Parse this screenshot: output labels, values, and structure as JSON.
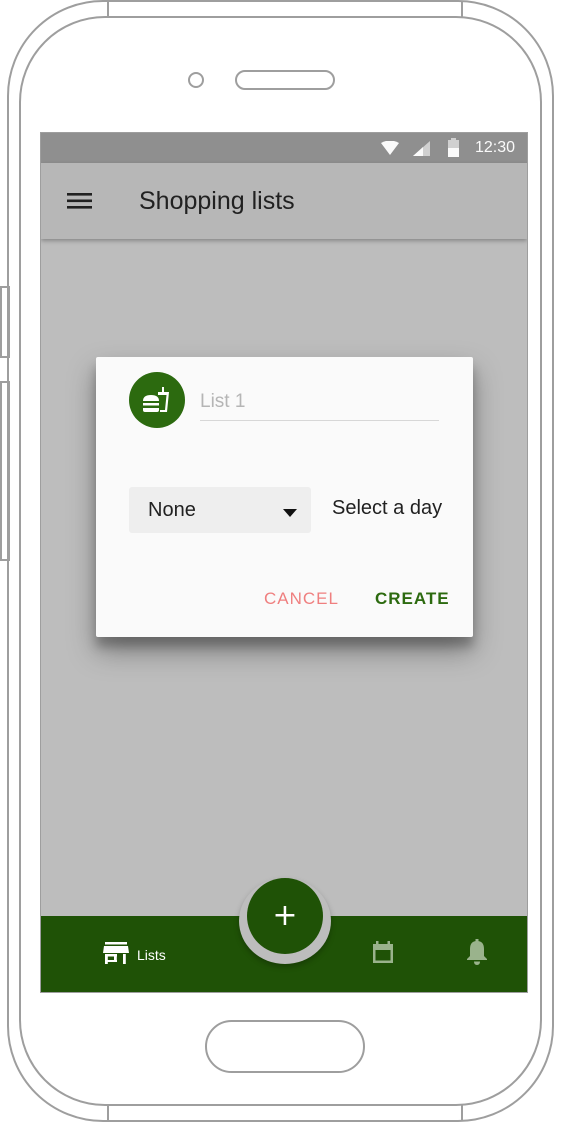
{
  "status_bar": {
    "time": "12:30"
  },
  "app_bar": {
    "title": "Shopping lists",
    "menu_icon": "hamburger-menu-icon"
  },
  "dialog": {
    "avatar_icon": "fastfood-icon",
    "name_placeholder": "List 1",
    "name_value": "",
    "day_dropdown": {
      "selected": "None"
    },
    "select_day_label": "Select a day",
    "cancel_label": "CANCEL",
    "create_label": "CREATE"
  },
  "bottom_nav": {
    "lists_label": "Lists",
    "fab_symbol": "+",
    "items": [
      "store-icon",
      "calendar-icon",
      "bell-icon"
    ]
  },
  "colors": {
    "primary": "#1f5206",
    "avatar": "#2c6a0f",
    "cancel": "#ef7f7f",
    "scrim": "#bdbdbd"
  }
}
